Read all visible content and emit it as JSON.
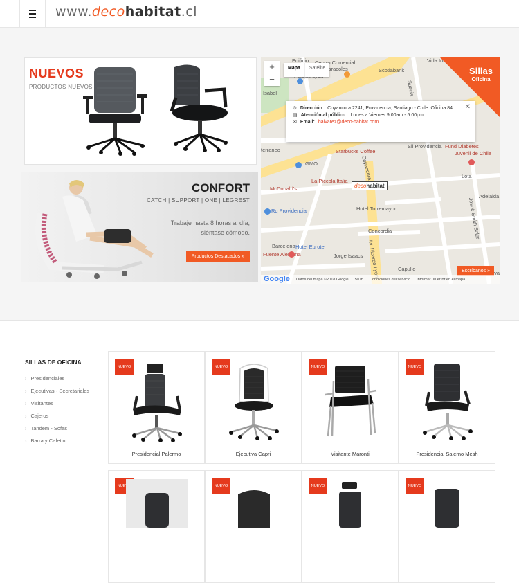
{
  "header": {
    "menu_icon": "hamburger-icon",
    "logo": {
      "www": "www.",
      "deco": "deco",
      "habitat": "habitat",
      "cl": ".cl"
    }
  },
  "hero": {
    "nuevos": {
      "title": "NUEVOS",
      "subtitle": "PRODUCTOS NUEVOS"
    },
    "confort": {
      "title": "CONFORT",
      "subtitle": "CATCH | SUPPORT | ONE | LEGREST",
      "text": "Trabaje hasta 8 horas al día, siéntase cómodo.",
      "button": "Productos Destacados »"
    }
  },
  "map": {
    "zoom_in": "+",
    "zoom_out": "−",
    "type_map": "Mapa",
    "type_sat": "Satélite",
    "info": {
      "direccion_label": "Dirección:",
      "direccion": "Coyancura 2241, Providencia, Santiago - Chile. Oficina 84",
      "atencion_label": "Atención al público:",
      "atencion": "Lunes a Viernes 9:00am - 5:00pm",
      "email_label": "Email:",
      "email": "halvarez@deco-habitat.com"
    },
    "ribbon": {
      "line1": "Sillas",
      "line2": "Oficina"
    },
    "button": "Escríbanos »",
    "marker": {
      "deco": "deco",
      "habitat": "habitat"
    },
    "labels": {
      "edificio": "Edificio",
      "centro": "Centro Comercial",
      "caracoles": "Caracoles",
      "scotiabank": "Scotiabank",
      "vida": "Vida Integra",
      "lyon": "Parque Lyon",
      "isabel": "Isabel",
      "suecia": "Suecia",
      "starbucks": "Starbucks Coffee",
      "sil": "Sil Providencia",
      "fund": "Fund Diabetes",
      "juvenil": "Juvenil de Chile",
      "gmo": "GMO",
      "terraneo": "terraneo",
      "piccola": "La Piccola Italia",
      "mcdonalds": "McDonald's",
      "rq": "Rq Providencia",
      "torre": "Hotel Torremayor",
      "eurotel": "Hotel Eurotel",
      "alemana": "Fuente Alemana",
      "lota": "Lota",
      "barcelona": "Barcelona",
      "concordia": "Concordia",
      "jorge": "Jorge Isaacs",
      "capullo": "Capullo",
      "lyon_av": "Av. Ricardo Lyon",
      "josue": "Josué Smith Solar",
      "adelaida": "Adelaida",
      "carmen": "Carmen Silva",
      "coyancura": "Coyancura"
    },
    "google": "Google",
    "footer": {
      "data": "Datos del mapa ©2018 Google",
      "scale": "50 m",
      "terms": "Condiciones del servicio",
      "report": "Informar un error en el mapa"
    }
  },
  "sidebar": {
    "title": "SILLAS DE OFICINA",
    "items": [
      "Presidenciales",
      "Ejecutivas - Secretariales",
      "Visitantes",
      "Cajeros",
      "Tandem - Sofas",
      "Barra y Cafetin"
    ]
  },
  "products": {
    "badge": "NUEVO",
    "items": [
      "Presidencial Palermo",
      "Ejecutiva Capri",
      "Visitante Maronti",
      "Presidencial Salerno Mesh",
      "",
      "",
      "",
      ""
    ]
  },
  "colors": {
    "accent": "#f15a24",
    "badge": "#e53a1d"
  }
}
